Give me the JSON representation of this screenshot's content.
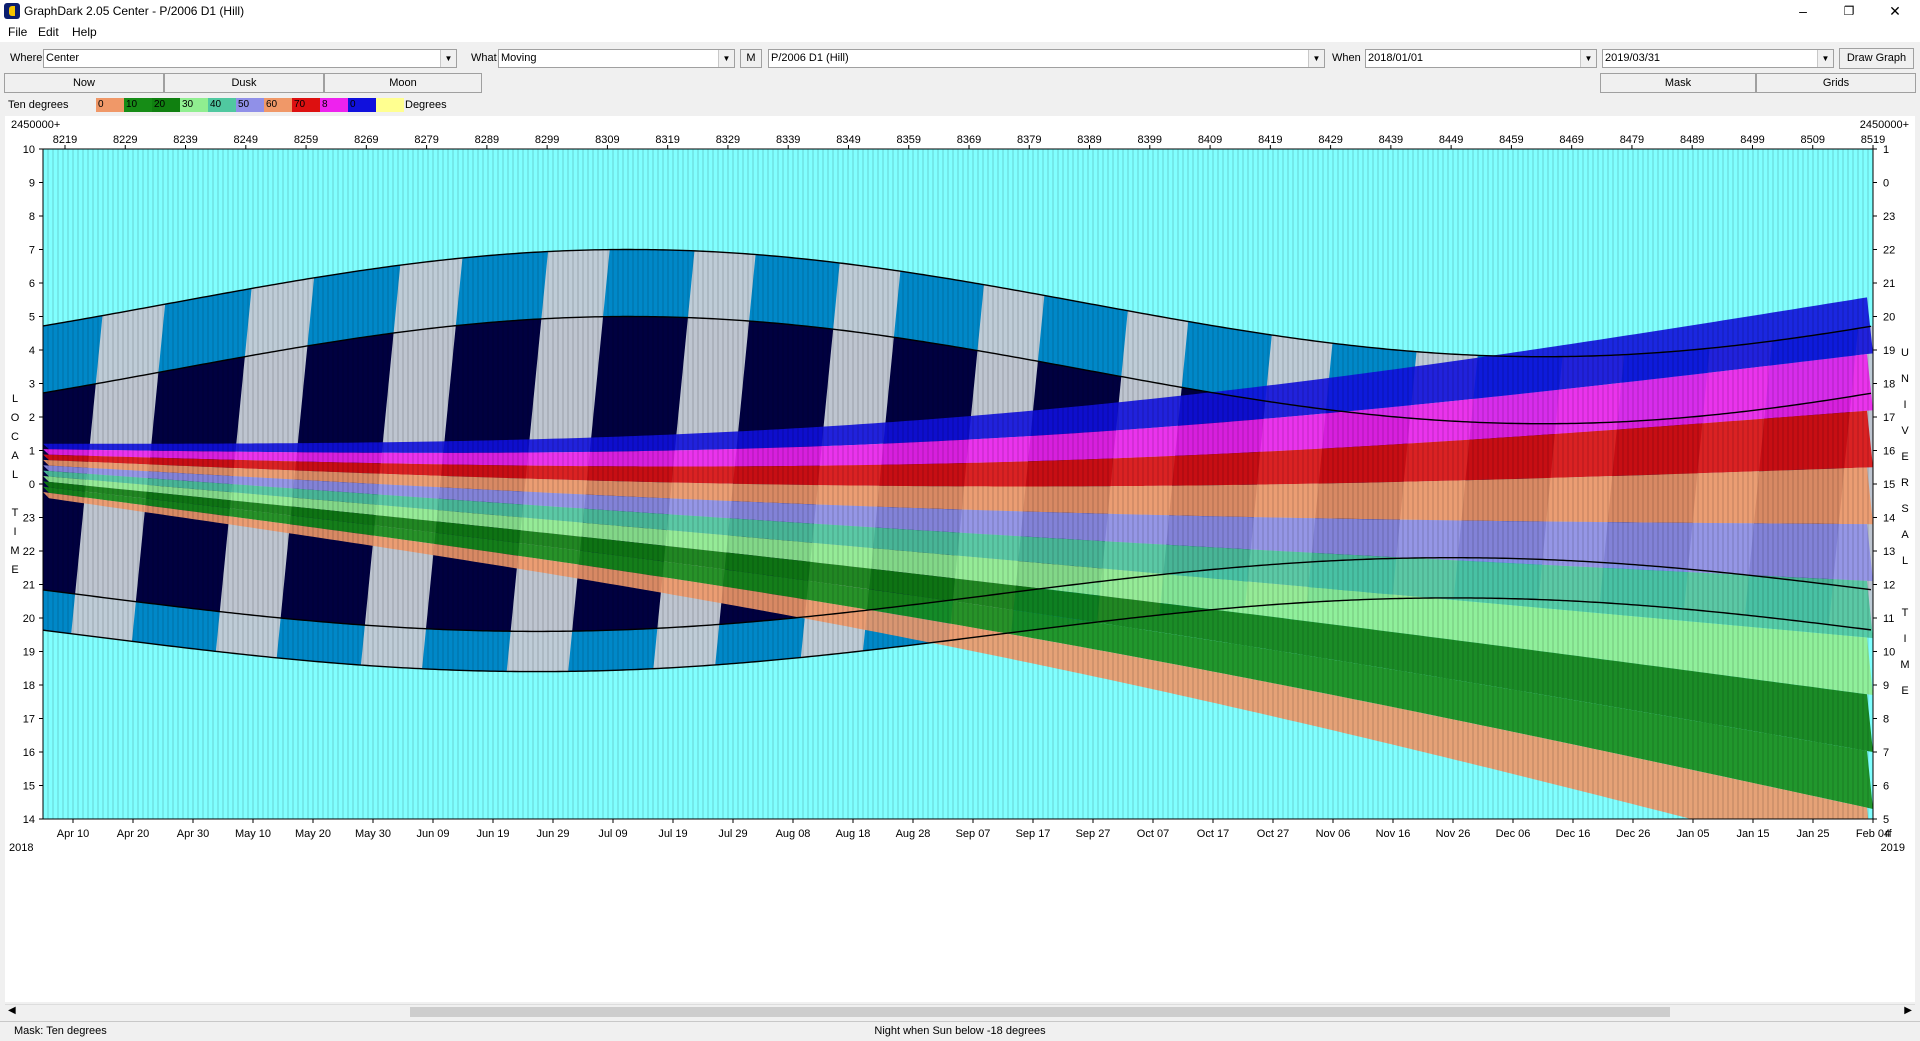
{
  "window": {
    "title": "GraphDark 2.05  Center  -  P/2006 D1 (Hill)",
    "minimize": "–",
    "maximize": "❐",
    "close": "✕"
  },
  "menu": [
    "File",
    "Edit",
    "Help"
  ],
  "toolbar": {
    "where_label": "Where",
    "where_value": "Center",
    "what_label": "What",
    "what_value": "Moving",
    "m_button": "M",
    "object_value": "P/2006 D1 (Hill)",
    "when_label": "When",
    "start_date": "2018/01/01",
    "end_date": "2019/03/31",
    "draw_button": "Draw Graph"
  },
  "buttons": {
    "now": "Now",
    "dusk": "Dusk",
    "moon": "Moon",
    "mask": "Mask",
    "grids": "Grids"
  },
  "legend": {
    "label": "Ten degrees",
    "units": "Degrees",
    "items": [
      {
        "text": "0",
        "color": "#f09868"
      },
      {
        "text": "10",
        "color": "#168c16"
      },
      {
        "text": "20",
        "color": "#108010"
      },
      {
        "text": "30",
        "color": "#90ee90"
      },
      {
        "text": "40",
        "color": "#50c8a0"
      },
      {
        "text": "50",
        "color": "#9090e8"
      },
      {
        "text": "60",
        "color": "#f09868"
      },
      {
        "text": "70",
        "color": "#dd1010"
      },
      {
        "text": "8",
        "color": "#ee22ee"
      },
      {
        "text": "0",
        "color": "#1010dd"
      },
      {
        "text": "",
        "color": "#ffff90"
      }
    ]
  },
  "graph": {
    "jd_prefix_left": "2450000+",
    "jd_prefix_right": "2450000+",
    "jd_ticks": [
      "8219",
      "8229",
      "8239",
      "8249",
      "8259",
      "8269",
      "8279",
      "8289",
      "8299",
      "8309",
      "8319",
      "8329",
      "8339",
      "8349",
      "8359",
      "8369",
      "8379",
      "8389",
      "8399",
      "8409",
      "8419",
      "8429",
      "8439",
      "8449",
      "8459",
      "8469",
      "8479",
      "8489",
      "8499",
      "8509",
      "8519"
    ],
    "date_ticks": [
      "Apr 10",
      "Apr 20",
      "Apr 30",
      "May 10",
      "May 20",
      "May 30",
      "Jun 09",
      "Jun 19",
      "Jun 29",
      "Jul 09",
      "Jul 19",
      "Jul 29",
      "Aug 08",
      "Aug 18",
      "Aug 28",
      "Sep 07",
      "Sep 17",
      "Sep 27",
      "Oct 07",
      "Oct 17",
      "Oct 27",
      "Nov 06",
      "Nov 16",
      "Nov 26",
      "Dec 06",
      "Dec 16",
      "Dec 26",
      "Jan 05",
      "Jan 15",
      "Jan 25",
      "Feb 04"
    ],
    "date_end_suffix": "rf",
    "year_left": "2018",
    "year_right": "2019",
    "left_axis_ticks": [
      "10",
      "9",
      "8",
      "7",
      "6",
      "5",
      "4",
      "3",
      "2",
      "1",
      "0",
      "23",
      "22",
      "21",
      "20",
      "19",
      "18",
      "17",
      "16",
      "15",
      "14"
    ],
    "right_axis_ticks": [
      "1",
      "0",
      "23",
      "22",
      "21",
      "20",
      "19",
      "18",
      "17",
      "16",
      "15",
      "14",
      "13",
      "12",
      "11",
      "10",
      "9",
      "8",
      "7",
      "6",
      "5"
    ],
    "left_title_letters": [
      "L",
      "O",
      "C",
      "A",
      "L",
      "",
      "T",
      "I",
      "M",
      "E"
    ],
    "right_title_letters": [
      "U",
      "N",
      "I",
      "V",
      "E",
      "R",
      "S",
      "A",
      "L",
      "",
      "T",
      "I",
      "M",
      "E"
    ],
    "colors": {
      "sky": "#80ffff",
      "night": "#000040",
      "twilight": "#0088c8",
      "moonlight": "#c8d0d8"
    }
  },
  "status": {
    "mask": "Mask:  Ten degrees",
    "night": "Night when Sun below -18 degrees"
  }
}
